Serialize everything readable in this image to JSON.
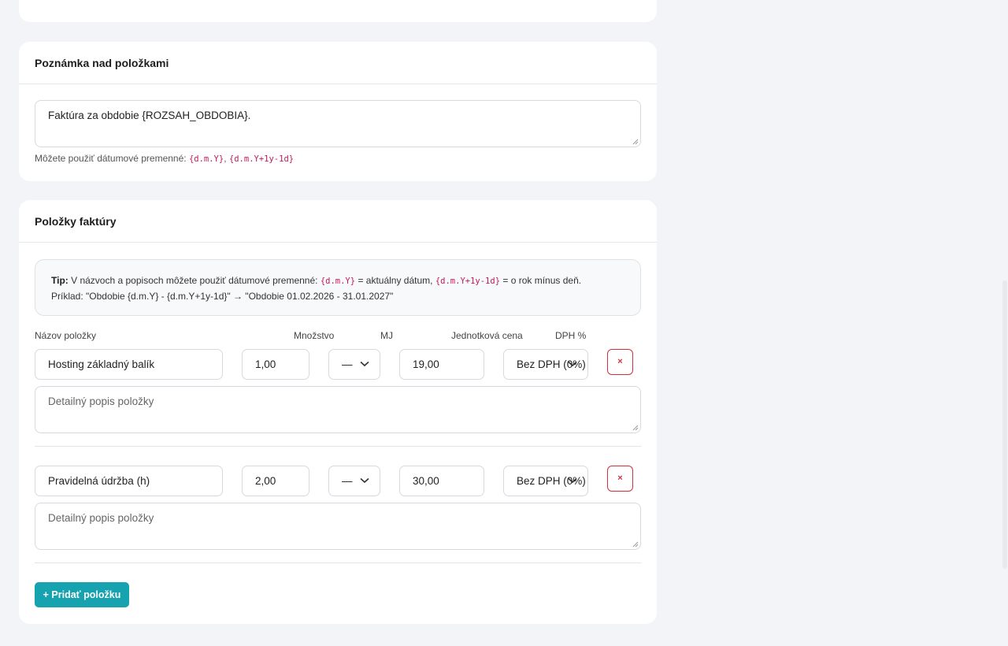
{
  "note_section": {
    "title": "Poznámka nad položkami",
    "note_value": "Faktúra za obdobie {ROZSAH_OBDOBIA}.",
    "hint_prefix": "Môžete použiť dátumové premenné:",
    "var1": "{d.m.Y}",
    "sep": ",",
    "var2": "{d.m.Y+1y-1d}"
  },
  "items_section": {
    "title": "Položky faktúry",
    "tip": {
      "label": "Tip:",
      "text1": "V názvoch a popisoch môžete použiť dátumové premenné:",
      "var1": "{d.m.Y}",
      "text2": "= aktuálny dátum,",
      "var2": "{d.m.Y+1y-1d}",
      "text3": "= o rok mínus deň.",
      "example": "Príklad: \"Obdobie {d.m.Y} - {d.m.Y+1y-1d}\" → \"Obdobie 01.02.2026 - 31.01.2027\""
    },
    "columns": {
      "name": "Názov položky",
      "qty": "Množstvo",
      "unit": "MJ",
      "price": "Jednotková cena",
      "vat": "DPH %"
    },
    "rows": [
      {
        "name": "Hosting základný balík",
        "qty": "1,00",
        "unit": "—",
        "price": "19,00",
        "vat": "Bez DPH (0%)",
        "description_placeholder": "Detailný popis položky",
        "delete_label": "×"
      },
      {
        "name": "Pravidelná údržba (h)",
        "qty": "2,00",
        "unit": "—",
        "price": "30,00",
        "vat": "Bez DPH (0%)",
        "description_placeholder": "Detailný popis položky",
        "delete_label": "×"
      }
    ],
    "add_button": "+ Pridať položku"
  },
  "colors": {
    "accent": "#17a2b0",
    "danger": "#d0313d",
    "code": "#c2185b",
    "background": "#f3f4f7"
  }
}
